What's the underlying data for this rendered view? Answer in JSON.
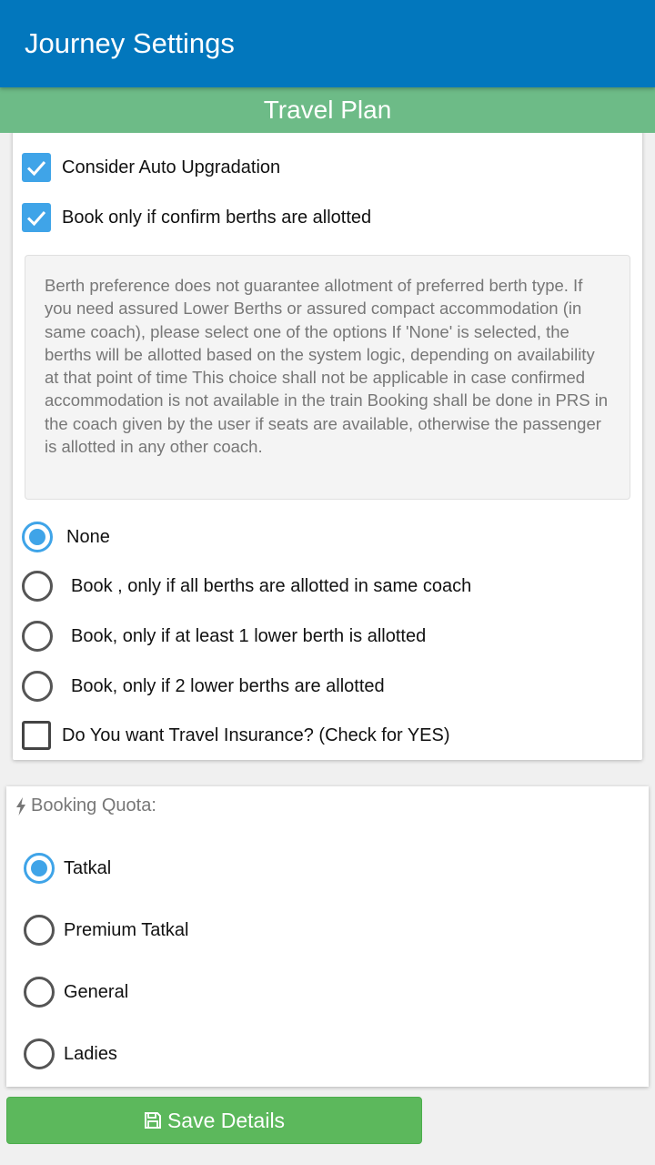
{
  "header": {
    "title": "Journey Settings"
  },
  "subheader": {
    "title": "Travel Plan"
  },
  "options": {
    "auto_upgrade": {
      "label": "Consider Auto Upgradation",
      "checked": true
    },
    "confirm_berths": {
      "label": "Book only if confirm berths are allotted",
      "checked": true
    }
  },
  "info_text": " Berth preference does not guarantee allotment of preferred berth type. If you need assured Lower Berths or assured compact accommodation (in same coach), please select one of the options If 'None' is selected, the berths will be allotted based on the system logic, depending on availability at that point of time This choice shall not be applicable in case confirmed accommodation is not available in the train Booking shall be done in PRS in the coach given by the user if seats are available, otherwise the passenger is allotted in any other coach.",
  "berth_options": [
    {
      "label": "None",
      "selected": true
    },
    {
      "label": "Book , only if all berths are allotted in same coach",
      "selected": false
    },
    {
      "label": "Book, only if at least 1 lower berth is allotted",
      "selected": false
    },
    {
      "label": "Book, only if 2 lower berths are allotted",
      "selected": false
    }
  ],
  "insurance": {
    "label": "Do You want Travel Insurance? (Check for YES)",
    "checked": false
  },
  "quota": {
    "title": "Booking Quota:",
    "icon": "bolt-icon",
    "options": [
      {
        "label": "Tatkal",
        "selected": true
      },
      {
        "label": "Premium Tatkal",
        "selected": false
      },
      {
        "label": "General",
        "selected": false
      },
      {
        "label": "Ladies",
        "selected": false
      }
    ]
  },
  "save_button": {
    "label": "Save Details",
    "icon": "floppy-disk-icon"
  },
  "colors": {
    "appbar": "#0277bd",
    "subheader": "#6dbb87",
    "accent": "#3fa4e8",
    "save": "#5cb85c"
  }
}
